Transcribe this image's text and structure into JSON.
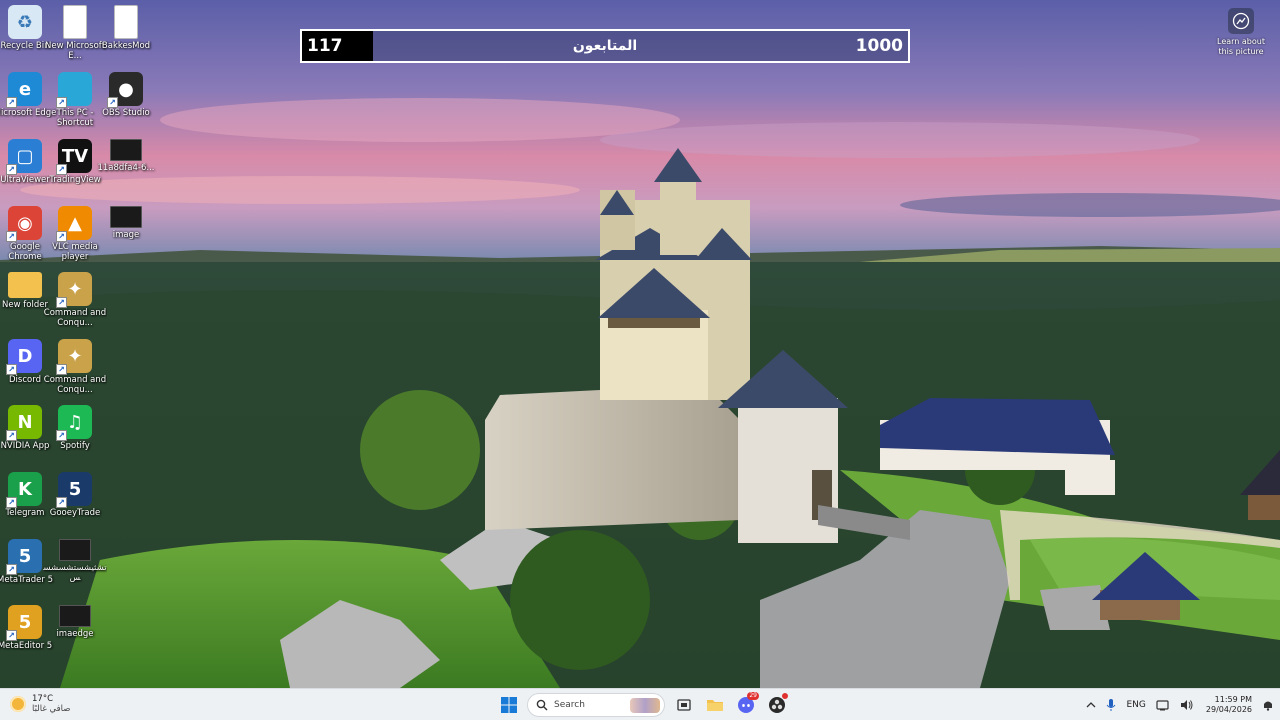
{
  "desktop_icons": [
    {
      "id": "recycle-bin",
      "label": "Recycle Bin",
      "icon": "recycle-bin-icon",
      "color": "#d8e8f4"
    },
    {
      "id": "new-doc",
      "label": "New Microsoft E...",
      "icon": "document-icon",
      "color": "#ffffff"
    },
    {
      "id": "bakkesmod",
      "label": "BakkesMod",
      "icon": "document-icon",
      "color": "#ffffff"
    },
    {
      "id": "edge",
      "label": "Microsoft Edge",
      "icon": "edge-icon",
      "color": "#1e8ad6"
    },
    {
      "id": "this-pc",
      "label": "This PC - Shortcut",
      "icon": "monitor-icon",
      "color": "#29a8d8"
    },
    {
      "id": "obs",
      "label": "OBS Studio",
      "icon": "obs-icon",
      "color": "#2a2a2a"
    },
    {
      "id": "ultraviewer",
      "label": "UltraViewer",
      "icon": "ultraviewer-icon",
      "color": "#2a7fd4"
    },
    {
      "id": "tradingview",
      "label": "TradingView",
      "icon": "tradingview-icon",
      "color": "#111111"
    },
    {
      "id": "file-11a8",
      "label": "11a8dfa4-6...",
      "icon": "image-thumb-icon",
      "color": "#1a1a1a"
    },
    {
      "id": "chrome",
      "label": "Google Chrome",
      "icon": "chrome-icon",
      "color": "#db4437"
    },
    {
      "id": "vlc",
      "label": "VLC media player",
      "icon": "vlc-icon",
      "color": "#f08a00"
    },
    {
      "id": "image",
      "label": "image",
      "icon": "image-thumb-icon",
      "color": "#1a1a1a"
    },
    {
      "id": "new-folder",
      "label": "New folder",
      "icon": "folder-icon",
      "color": "#f2c14e"
    },
    {
      "id": "cnc1",
      "label": "Command and Conqu...",
      "icon": "cnc-icon",
      "color": "#c9a24a"
    },
    {
      "id": "discord",
      "label": "Discord",
      "icon": "discord-icon",
      "color": "#5865f2"
    },
    {
      "id": "cnc2",
      "label": "Command and Conqu...",
      "icon": "cnc-icon",
      "color": "#c9a24a"
    },
    {
      "id": "nvidia",
      "label": "NVIDIA App",
      "icon": "nvidia-icon",
      "color": "#76b900"
    },
    {
      "id": "spotify",
      "label": "Spotify",
      "icon": "spotify-icon",
      "color": "#1db954"
    },
    {
      "id": "telegram",
      "label": "Telegram",
      "icon": "telegram-icon",
      "color": "#1aa04a"
    },
    {
      "id": "gooeytrade",
      "label": "GooeyTrade",
      "icon": "gooeytrade-icon",
      "color": "#1a3a6a"
    },
    {
      "id": "metatrader",
      "label": "MetaTrader 5",
      "icon": "metatrader-icon",
      "color": "#2a6fb0"
    },
    {
      "id": "arabic-file",
      "label": "تشثيشستشسشسس",
      "icon": "image-thumb-icon",
      "color": "#1a1a1a"
    },
    {
      "id": "metaeditor",
      "label": "MetaEditor 5",
      "icon": "metaeditor-icon",
      "color": "#e0a020"
    },
    {
      "id": "imaedge",
      "label": "imaedge",
      "icon": "image-thumb-icon",
      "color": "#1a1a1a"
    }
  ],
  "follower_bar": {
    "current": "117",
    "goal": "1000",
    "title": "المتابعون",
    "progress_fraction": 0.117,
    "fill_color": "#000000"
  },
  "learn_widget": {
    "label": "Learn about this picture",
    "icon": "camera-icon"
  },
  "taskbar": {
    "weather_temp": "17°C",
    "weather_desc": "صافي غالبًا",
    "search_placeholder": "Search",
    "pinned": [
      {
        "id": "start",
        "icon": "windows-start-icon"
      },
      {
        "id": "task-view",
        "icon": "task-view-icon"
      },
      {
        "id": "file-explorer",
        "icon": "folder-icon"
      },
      {
        "id": "discord",
        "icon": "discord-icon",
        "badge": "29"
      },
      {
        "id": "obs",
        "icon": "obs-icon"
      }
    ],
    "tray": {
      "language": "ENG",
      "time": "11:59 PM",
      "date": "29/04/2026"
    }
  },
  "colors": {
    "taskbar_bg": "#eef1f4",
    "accent_blue": "#0067c0"
  }
}
